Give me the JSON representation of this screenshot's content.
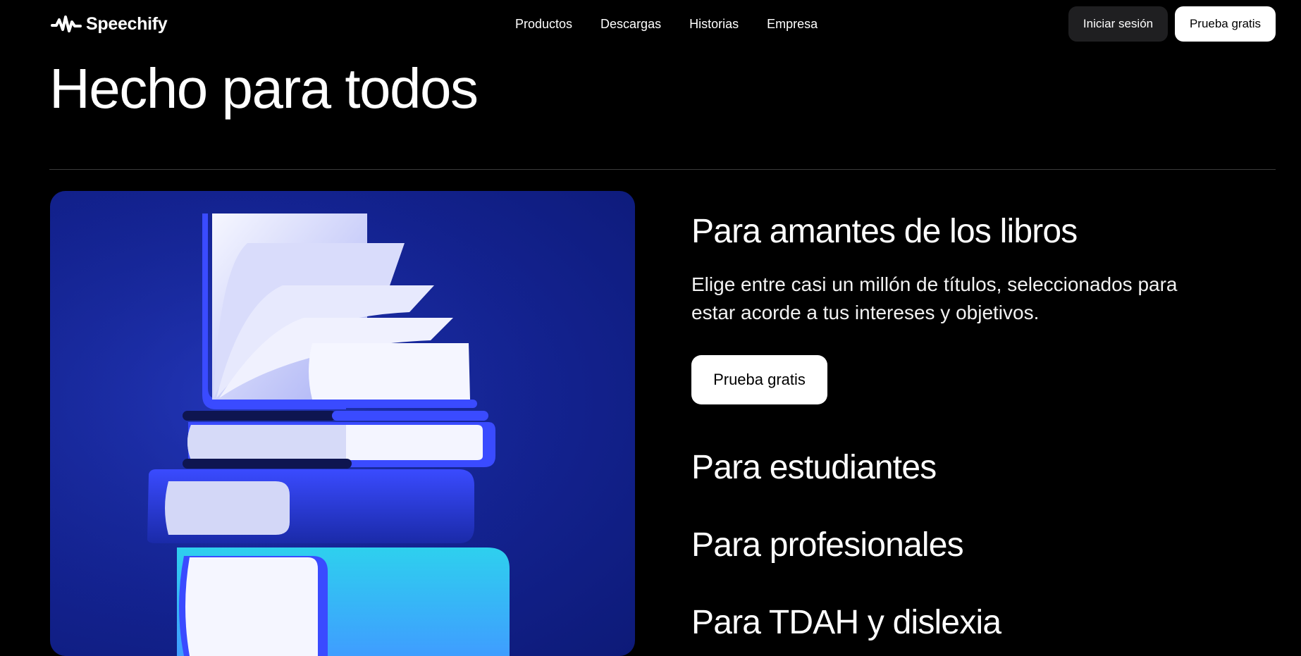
{
  "header": {
    "brand": "Speechify",
    "nav": [
      "Productos",
      "Descargas",
      "Historias",
      "Empresa"
    ],
    "login_label": "Iniciar sesión",
    "trial_label": "Prueba gratis"
  },
  "hero": {
    "title": "Hecho para todos"
  },
  "sections": {
    "active": {
      "title": "Para amantes de los libros",
      "description": "Elige entre casi un millón de títulos, seleccionados para estar acorde a tus intereses y objetivos.",
      "cta_label": "Prueba gratis"
    },
    "others": [
      "Para estudiantes",
      "Para profesionales",
      "Para TDAH y dislexia"
    ]
  },
  "icons": {
    "logo": "speechify-waveform-icon",
    "illustration": "book-stack-illustration"
  },
  "colors": {
    "background": "#000000",
    "card_bg": "#13228f",
    "book_blue": "#3a4bff",
    "book_cyan": "#2ec6ea",
    "page_white": "#eef0ff",
    "button_dark": "#1f1f21"
  }
}
